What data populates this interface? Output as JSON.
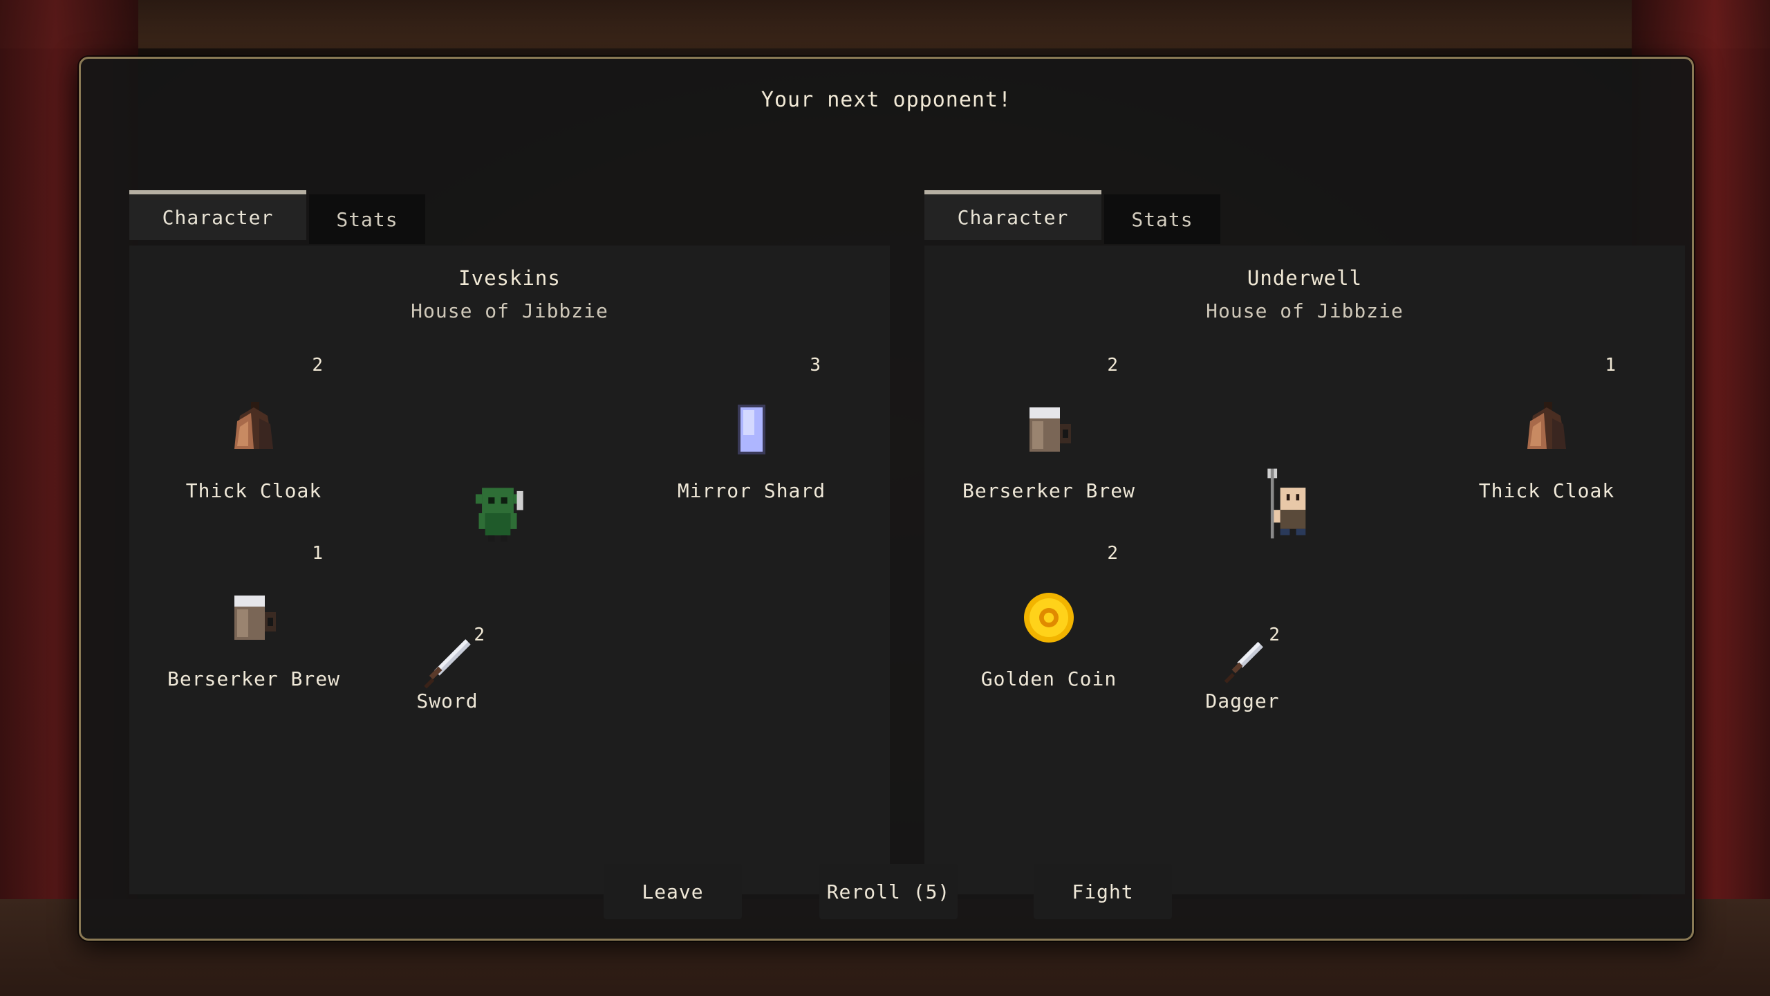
{
  "title": "Your next opponent!",
  "player": {
    "tabs": [
      {
        "label": "Character"
      },
      {
        "label": "Stats"
      }
    ],
    "name": "Iveskins",
    "house": "House of Jibbzie",
    "items": [
      {
        "name": "Thick Cloak",
        "count": "2",
        "icon": "cloak-icon"
      },
      {
        "name": "Mirror Shard",
        "count": "3",
        "icon": "mirror-shard-icon"
      },
      {
        "name": "Berserker Brew",
        "count": "1",
        "icon": "brew-mug-icon"
      }
    ],
    "weapon": {
      "name": "Sword",
      "count": "2",
      "icon": "sword-icon"
    },
    "portrait": "goblin-portrait"
  },
  "opponent": {
    "tabs": [
      {
        "label": "Character"
      },
      {
        "label": "Stats"
      }
    ],
    "name": "Underwell",
    "house": "House of Jibbzie",
    "items": [
      {
        "name": "Berserker Brew",
        "count": "2",
        "icon": "brew-mug-icon"
      },
      {
        "name": "Thick Cloak",
        "count": "1",
        "icon": "cloak-icon"
      },
      {
        "name": "Golden Coin",
        "count": "2",
        "icon": "gold-coin-icon"
      }
    ],
    "weapon": {
      "name": "Dagger",
      "count": "2",
      "icon": "dagger-icon"
    },
    "portrait": "human-pitchfork-portrait"
  },
  "buttons": {
    "leave": "Leave",
    "reroll": "Reroll (5)",
    "fight": "Fight"
  },
  "colors": {
    "dialog_border": "#8a7a55",
    "text": "#efe8d8",
    "panel": "#1e1e1e"
  }
}
